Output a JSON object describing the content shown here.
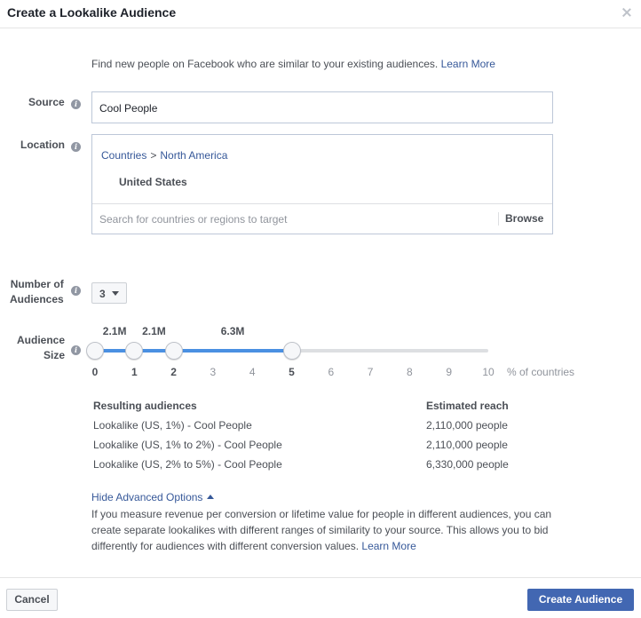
{
  "dialog": {
    "title": "Create a Lookalike Audience",
    "intro_text": "Find new people on Facebook who are similar to your existing audiences.",
    "intro_link": "Learn More"
  },
  "source": {
    "label": "Source",
    "value": "Cool People"
  },
  "location": {
    "label": "Location",
    "breadcrumb_root": "Countries",
    "breadcrumb_separator": ">",
    "breadcrumb_region": "North America",
    "selected_country": "United States",
    "search_placeholder": "Search for countries or regions to target",
    "browse_label": "Browse"
  },
  "num_audiences": {
    "label_line1": "Number of",
    "label_line2": "Audiences",
    "value": "3"
  },
  "audience_size": {
    "label_line1": "Audience",
    "label_line2": "Size",
    "ticks": [
      "0",
      "1",
      "2",
      "3",
      "4",
      "5",
      "6",
      "7",
      "8",
      "9",
      "10"
    ],
    "unit_label": "% of countries",
    "reach_labels": [
      "2.1M",
      "2.1M",
      "6.3M"
    ],
    "selected_percents": [
      0,
      1,
      2,
      5
    ]
  },
  "results": {
    "header_audience": "Resulting audiences",
    "header_reach": "Estimated reach",
    "rows": [
      {
        "name": "Lookalike (US, 1%) - Cool People",
        "reach": "2,110,000 people"
      },
      {
        "name": "Lookalike (US, 1% to 2%) - Cool People",
        "reach": "2,110,000 people"
      },
      {
        "name": "Lookalike (US, 2% to 5%) - Cool People",
        "reach": "6,330,000 people"
      }
    ]
  },
  "advanced": {
    "toggle_label": "Hide Advanced Options",
    "description": "If you measure revenue per conversion or lifetime value for people in different audiences, you can create separate lookalikes with different ranges of similarity to your source. This allows you to bid differently for audiences with different conversion values.",
    "learn_more": "Learn More"
  },
  "footer": {
    "cancel_label": "Cancel",
    "create_label": "Create Audience"
  },
  "colors": {
    "link": "#365899",
    "accent": "#4267b2",
    "slider_fill": "#4a90e2"
  }
}
